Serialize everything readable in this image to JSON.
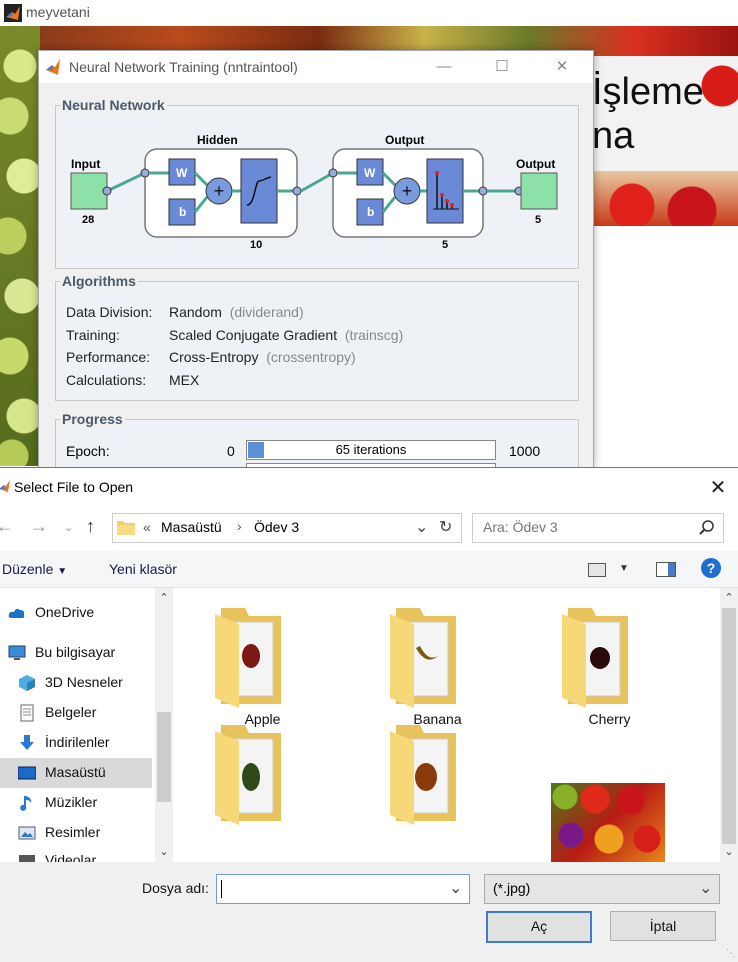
{
  "app": {
    "title": "meyvetani",
    "slide_text": [
      "İşleme",
      "na"
    ]
  },
  "nntool": {
    "title": "Neural Network Training (nntraintool)",
    "network": {
      "group_title": "Neural Network",
      "input_label": "Input",
      "input_size": "28",
      "hidden_label": "Hidden",
      "hidden_size": "10",
      "output_layer_label": "Output",
      "output_layer_size": "5",
      "output_label": "Output",
      "output_size": "5",
      "w": "W",
      "b": "b"
    },
    "algorithms": {
      "group_title": "Algorithms",
      "rows": [
        {
          "label": "Data Division:",
          "value": "Random",
          "paren": "(dividerand)"
        },
        {
          "label": "Training:",
          "value": "Scaled Conjugate Gradient",
          "paren": "(trainscg)"
        },
        {
          "label": "Performance:",
          "value": "Cross-Entropy",
          "paren": "(crossentropy)"
        },
        {
          "label": "Calculations:",
          "value": "MEX",
          "paren": ""
        }
      ]
    },
    "progress": {
      "group_title": "Progress",
      "epoch_label": "Epoch:",
      "min": "0",
      "max": "1000",
      "text": "65 iterations",
      "fraction": 0.065
    }
  },
  "dialog": {
    "title": "Select File to Open",
    "breadcrumb": {
      "prefix": "«",
      "items": [
        "Masaüstü",
        "Ödev 3"
      ]
    },
    "search_placeholder": "Ara: Ödev 3",
    "organize": "Düzenle",
    "new_folder": "Yeni klasör",
    "sidebar": [
      {
        "label": "OneDrive",
        "icon": "cloud-icon"
      },
      {
        "label": "Bu bilgisayar",
        "icon": "computer-icon"
      },
      {
        "label": "3D Nesneler",
        "icon": "cube-icon"
      },
      {
        "label": "Belgeler",
        "icon": "document-icon"
      },
      {
        "label": "İndirilenler",
        "icon": "download-arrow-icon"
      },
      {
        "label": "Masaüstü",
        "icon": "desktop-icon",
        "selected": true
      },
      {
        "label": "Müzikler",
        "icon": "music-note-icon"
      },
      {
        "label": "Resimler",
        "icon": "pictures-icon"
      },
      {
        "label": "Videolar",
        "icon": "video-icon"
      }
    ],
    "files": [
      {
        "name": "Apple",
        "kind": "folder"
      },
      {
        "name": "Banana",
        "kind": "folder"
      },
      {
        "name": "Cherry",
        "kind": "folder"
      },
      {
        "name": "",
        "kind": "folder"
      },
      {
        "name": "",
        "kind": "folder"
      },
      {
        "name": "",
        "kind": "image"
      }
    ],
    "filename_label": "Dosya adı:",
    "filename_value": "",
    "filter": "(*.jpg)",
    "open_button": "Aç",
    "cancel_button": "İptal",
    "colors": {
      "accent": "#3c7dd0",
      "selected": "#d9d9d9",
      "help": "#1e6fd0"
    }
  }
}
